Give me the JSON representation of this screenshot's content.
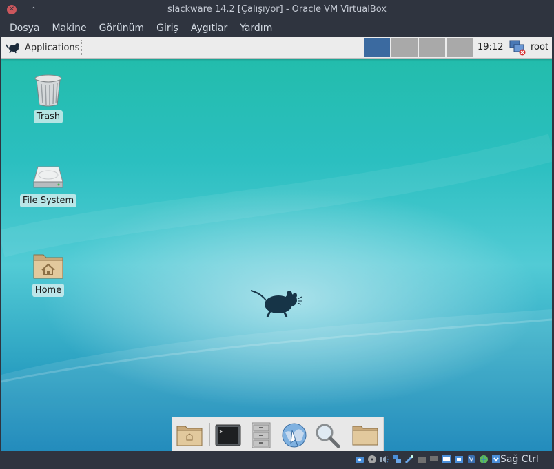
{
  "window": {
    "title": "slackware 14.2 [Çalışıyor] - Oracle VM VirtualBox",
    "close_glyph": "✕",
    "max_glyph": "⌃",
    "min_glyph": "‒"
  },
  "menubar": {
    "items": [
      {
        "label": "Dosya"
      },
      {
        "label": "Makine"
      },
      {
        "label": "Görünüm"
      },
      {
        "label": "Giriş"
      },
      {
        "label": "Aygıtlar"
      },
      {
        "label": "Yardım"
      }
    ]
  },
  "guest": {
    "panel": {
      "applications_label": "Applications",
      "workspaces": [
        {
          "active": true
        },
        {
          "active": false
        },
        {
          "active": false
        },
        {
          "active": false
        }
      ],
      "clock": "19:12",
      "user": "root",
      "icons": {
        "apps": "xfce-mouse-icon",
        "network": "network-disconnected-icon"
      }
    },
    "desktop_icons": [
      {
        "label": "Trash",
        "icon": "trash-icon"
      },
      {
        "label": "File System",
        "icon": "harddrive-icon"
      },
      {
        "label": "Home",
        "icon": "home-folder-icon"
      }
    ],
    "dock": [
      {
        "icon": "home-folder-icon"
      },
      {
        "icon": "terminal-icon"
      },
      {
        "icon": "file-cabinet-icon"
      },
      {
        "icon": "web-browser-icon"
      },
      {
        "icon": "search-icon"
      },
      {
        "icon": "folder-icon"
      }
    ],
    "colors": {
      "accent_workspace": "#3b6aa0",
      "panel_bg": "#ececec",
      "desktop_top": "#21bca8",
      "desktop_bottom": "#0b7fb5"
    }
  },
  "statusbar": {
    "host_key": "Sağ Ctrl",
    "icons": [
      "hard-disk-icon",
      "optical-drive-icon",
      "audio-icon",
      "network-icon",
      "usb-icon",
      "shared-folder-icon",
      "display-icon",
      "video-capture-icon",
      "cpu-icon",
      "mouse-integration-icon",
      "keyboard-icon"
    ]
  }
}
